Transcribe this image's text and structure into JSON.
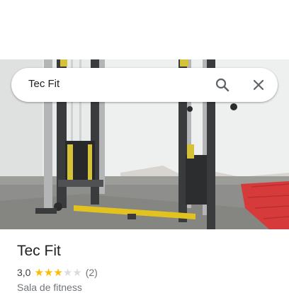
{
  "search": {
    "query": "Tec Fit"
  },
  "place": {
    "name": "Tec Fit",
    "rating_text": "3,0",
    "rating_value": 3,
    "rating_max": 5,
    "reviews_count": "(2)",
    "category": "Sala de fitness"
  },
  "icons": {
    "search": "search-icon",
    "close": "close-icon",
    "star": "star-icon"
  },
  "colors": {
    "star_full": "#fbbc04",
    "star_empty": "#dadce0",
    "text_primary": "#202124",
    "text_secondary": "#70757a"
  }
}
